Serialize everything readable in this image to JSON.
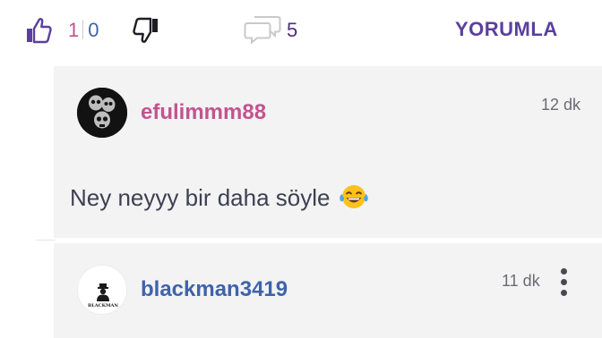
{
  "actions": {
    "like_count": "1",
    "dislike_count": "0",
    "comment_count": "5",
    "comment_button_label": "YORUMLA"
  },
  "comments": [
    {
      "username": "efulimmm88",
      "time": "12 dk",
      "text": "Ney neyyy bir daha söyle",
      "emoji": "face-with-tears-of-joy",
      "username_color": "#c2548f"
    },
    {
      "username": "blackman3419",
      "time": "11 dk",
      "avatar_logo_text": "BLACKMAN",
      "username_color": "#3f63a8"
    }
  ],
  "colors": {
    "accent_purple": "#5b3fa0",
    "card_background": "#f3f3f4"
  }
}
